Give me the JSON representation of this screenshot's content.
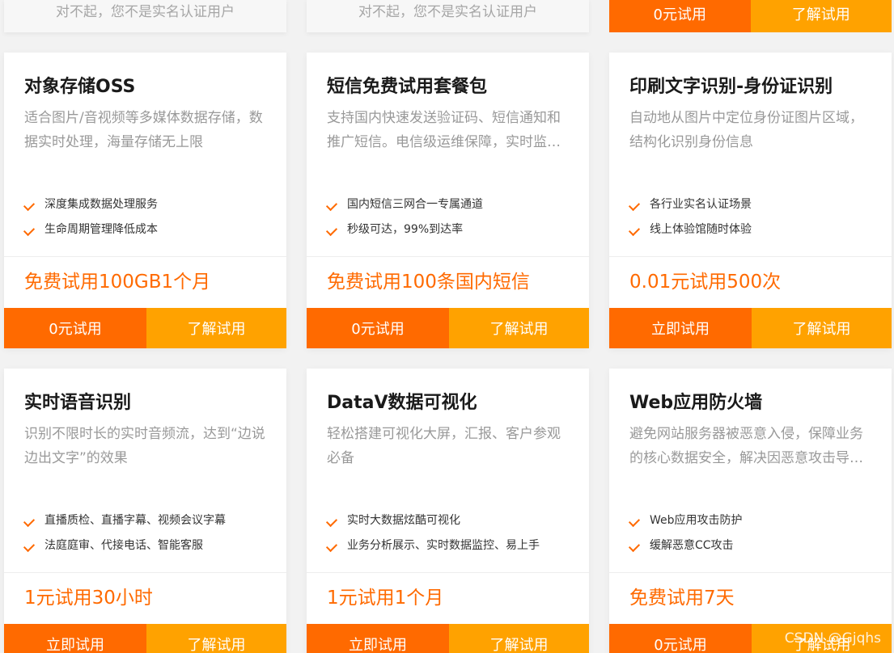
{
  "top_row": {
    "cards": [
      {
        "message": "对不起，您不是实名认证用户"
      },
      {
        "message": "对不起，您不是实名认证用户"
      }
    ],
    "buttons": {
      "primary": "0元试用",
      "secondary": "了解试用"
    }
  },
  "products": [
    {
      "title": "对象存储OSS",
      "description": "适合图片/音视频等多媒体数据存储，数据实时处理，海量存储无上限",
      "features": [
        "深度集成数据处理服务",
        "生命周期管理降低成本"
      ],
      "promo": "免费试用100GB1个月",
      "primary_btn": "0元试用",
      "secondary_btn": "了解试用"
    },
    {
      "title": "短信免费试用套餐包",
      "description": "支持国内快速发送验证码、短信通知和推广短信。电信级运维保障，实时监控自动切换",
      "features": [
        "国内短信三网合一专属通道",
        "秒级可达，99%到达率"
      ],
      "promo": "免费试用100条国内短信",
      "primary_btn": "0元试用",
      "secondary_btn": "了解试用"
    },
    {
      "title": "印刷文字识别-身份证识别",
      "description": "自动地从图片中定位身份证图片区域，结构化识别身份信息",
      "features": [
        "各行业实名认证场景",
        "线上体验馆随时体验"
      ],
      "promo": "0.01元试用500次",
      "primary_btn": "立即试用",
      "secondary_btn": "了解试用"
    },
    {
      "title": "实时语音识别",
      "description": "识别不限时长的实时音频流，达到“边说边出文字”的效果",
      "features": [
        "直播质检、直播字幕、视频会议字幕",
        "法庭庭审、代接电话、智能客服"
      ],
      "promo": "1元试用30小时",
      "primary_btn": "立即试用",
      "secondary_btn": "了解试用"
    },
    {
      "title": "DataV数据可视化",
      "description": "轻松搭建可视化大屏，汇报、客户参观必备",
      "features": [
        "实时大数据炫酷可视化",
        "业务分析展示、实时数据监控、易上手"
      ],
      "promo": "1元试用1个月",
      "primary_btn": "立即试用",
      "secondary_btn": "了解试用"
    },
    {
      "title": "Web应用防火墙",
      "description": "避免网站服务器被恶意入侵，保障业务的核心数据安全，解决因恶意攻击导致的服务器性能异常问题",
      "features": [
        "Web应用攻击防护",
        "缓解恶意CC攻击"
      ],
      "promo": "免费试用7天",
      "primary_btn": "0元试用",
      "secondary_btn": "了解试用"
    }
  ],
  "watermark": "CSDN @Gjqhs",
  "colors": {
    "primary_button": "#ff6a00",
    "secondary_button": "#ffa200",
    "promo_text": "#ff6a00",
    "check_icon": "#ff6a00"
  }
}
